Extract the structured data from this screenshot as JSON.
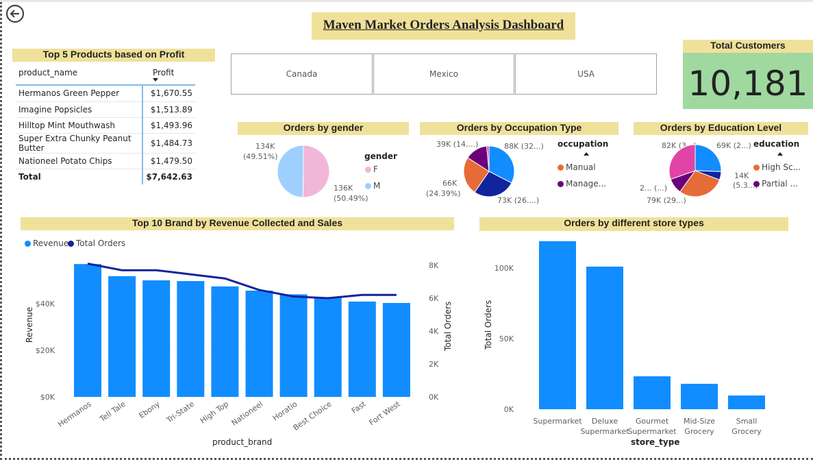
{
  "dashboard": {
    "title": "Maven Market Orders Analysis Dashboard",
    "back_icon": "back-arrow-icon"
  },
  "top_products": {
    "title": "Top 5 Products based on Profit",
    "col_name": "product_name",
    "col_profit": "Profit",
    "rows": [
      {
        "name": "Hermanos Green Pepper",
        "profit": "$1,670.55"
      },
      {
        "name": "Imagine Popsicles",
        "profit": "$1,513.89"
      },
      {
        "name": "Hilltop Mint Mouthwash",
        "profit": "$1,493.96"
      },
      {
        "name": "Super Extra Chunky Peanut Butter",
        "profit": "$1,484.73"
      },
      {
        "name": "Nationeel Potato Chips",
        "profit": "$1,479.50"
      }
    ],
    "total_label": "Total",
    "total_value": "$7,642.63"
  },
  "country_slicer": [
    "Canada",
    "Mexico",
    "USA"
  ],
  "total_customers": {
    "title": "Total Customers",
    "value": "10,181",
    "color": "#a0d9a0"
  },
  "gender_pie": {
    "title": "Orders by gender",
    "legend_title": "gender",
    "legend": [
      "F",
      "M"
    ],
    "labels": {
      "m": "134K",
      "m_pct": "(49.51%)",
      "f": "136K",
      "f_pct": "(50.49%)"
    }
  },
  "occupation_pie": {
    "title": "Orders by Occupation Type",
    "legend_title": "occupation",
    "legend": [
      "Manual",
      "Manage..."
    ],
    "labels": [
      "88K (32...)",
      "73K (26....)",
      "66K",
      "(24.39%)",
      "39K (14....)"
    ]
  },
  "education_pie": {
    "title": "Orders by Education Level",
    "legend_title": "education",
    "legend": [
      "High Sc...",
      "Partial ..."
    ],
    "labels": [
      "69K (2...)",
      "14K",
      "(5.3...)",
      "79K (29...)",
      "2... (...)",
      "82K (3...)"
    ]
  },
  "chart_data": [
    {
      "type": "pie",
      "title": "Orders by gender",
      "categories": [
        "F",
        "M"
      ],
      "values": [
        136000,
        134000
      ],
      "percent": [
        50.49,
        49.51
      ],
      "colors": [
        "#f2b6d9",
        "#9fcfff"
      ]
    },
    {
      "type": "pie",
      "title": "Orders by Occupation Type",
      "values": [
        88000,
        73000,
        66000,
        39000,
        4000
      ],
      "colors": [
        "#118dff",
        "#12239e",
        "#e66c37",
        "#6b007b",
        "#e044a7"
      ]
    },
    {
      "type": "pie",
      "title": "Orders by Education Level",
      "values": [
        69000,
        14000,
        79000,
        26000,
        82000
      ],
      "colors": [
        "#118dff",
        "#12239e",
        "#e66c37",
        "#6b007b",
        "#e044a7"
      ]
    },
    {
      "type": "bar",
      "title": "Top 10 Brand by Revenue Collected and Sales",
      "xlabel": "product_brand",
      "ylabel": "Revenue",
      "y2label": "Total Orders",
      "legend": [
        "Revenue",
        "Total Orders"
      ],
      "legend_position": "top-left",
      "categories": [
        "Hermanos",
        "Tell Tale",
        "Ebony",
        "Tri-State",
        "High Top",
        "Nationeel",
        "Horatio",
        "Best Choice",
        "Fast",
        "Fort West"
      ],
      "series": [
        {
          "name": "Revenue",
          "type": "bar",
          "color": "#118dff",
          "values": [
            57000,
            51800,
            50000,
            49700,
            47400,
            45600,
            44000,
            42600,
            40900,
            40300
          ]
        },
        {
          "name": "Total Orders",
          "type": "line",
          "color": "#12239e",
          "values": [
            8100,
            7700,
            7700,
            7450,
            7200,
            6500,
            6100,
            6000,
            6200,
            6200
          ]
        }
      ],
      "ylim": [
        0,
        60000
      ],
      "y2lim": [
        0,
        8500
      ],
      "yticks": [
        "$0K",
        "$20K",
        "$40K"
      ],
      "y2ticks": [
        "0K",
        "2K",
        "4K",
        "6K",
        "8K"
      ]
    },
    {
      "type": "bar",
      "title": "Orders by different store types",
      "xlabel": "store_type",
      "ylabel": "Total Orders",
      "categories": [
        [
          "Supermarket"
        ],
        [
          "Deluxe",
          "Supermarket"
        ],
        [
          "Gourmet",
          "Supermarket"
        ],
        [
          "Mid-Size",
          "Grocery"
        ],
        [
          "Small",
          "Grocery"
        ]
      ],
      "values": [
        119000,
        101000,
        23300,
        18000,
        9700
      ],
      "color": "#118dff",
      "ylim": [
        0,
        125000
      ],
      "yticks": [
        "0K",
        "50K",
        "100K"
      ]
    }
  ]
}
